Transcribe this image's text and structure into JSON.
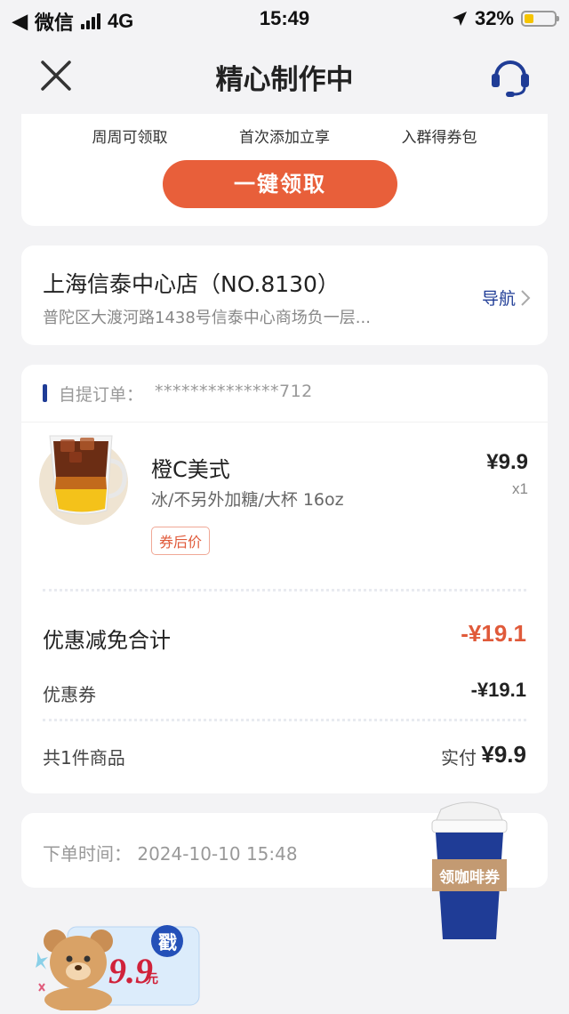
{
  "status_bar": {
    "back_app": "微信",
    "network": "4G",
    "time": "15:49",
    "battery": "32%"
  },
  "nav": {
    "title": "精心制作中"
  },
  "coupon_card": {
    "perks": [
      "周周可领取",
      "首次添加立享",
      "入群得券包"
    ],
    "claim_button": "一键领取"
  },
  "store": {
    "name": "上海信泰中心店（NO.8130）",
    "address": "普陀区大渡河路1438号信泰中心商场负一层...",
    "navigate_label": "导航"
  },
  "order": {
    "label": "自提订单：",
    "number": "**************712",
    "item": {
      "name": "橙C美式",
      "spec": "冰/不另外加糖/大杯 16oz",
      "tag": "券后价",
      "price": "¥9.9",
      "qty": "x1"
    },
    "discount_total_label": "优惠减免合计",
    "discount_total_value": "-¥19.1",
    "coupon_label": "优惠券",
    "coupon_value": "-¥19.1",
    "count_label": "共1件商品",
    "paid_label": "实付",
    "paid_value": "¥9.9"
  },
  "order_time": {
    "label": "下单时间：",
    "value": "2024-10-10 15:48"
  },
  "promo": {
    "cup_label": "领咖啡券",
    "bear_price": "9.9",
    "bear_unit": "元",
    "bear_stamp": "戳"
  },
  "colors": {
    "brand_blue": "#1f3c96",
    "accent_orange": "#e85f3a",
    "discount_red": "#e05a3a"
  }
}
